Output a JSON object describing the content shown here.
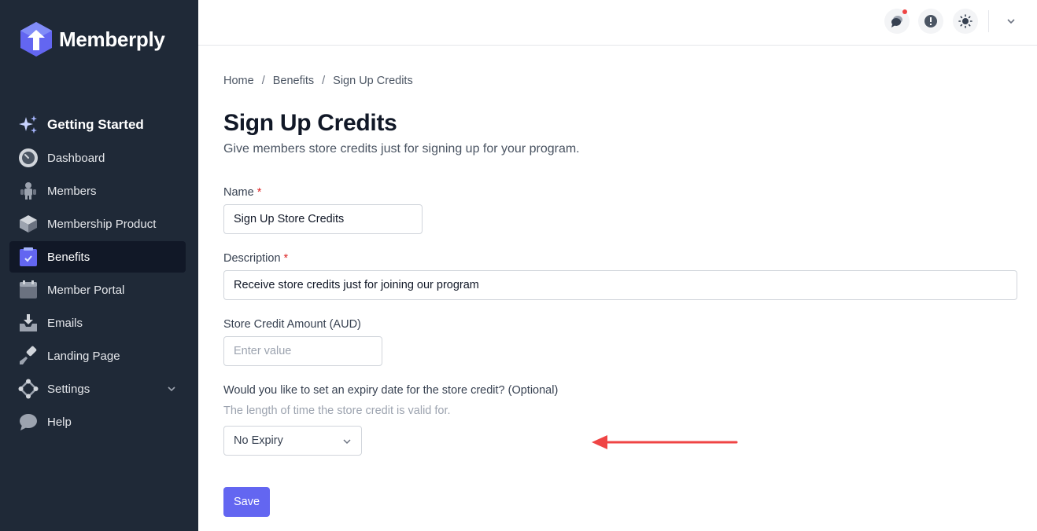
{
  "brand": {
    "name": "Memberply",
    "accent": "#6366f1",
    "sidebar_bg": "#1f2937"
  },
  "sidebar": {
    "items": [
      {
        "label": "Getting Started",
        "icon": "sparkles-icon"
      },
      {
        "label": "Dashboard",
        "icon": "gauge-icon"
      },
      {
        "label": "Members",
        "icon": "users-icon"
      },
      {
        "label": "Membership Product",
        "icon": "cube-icon"
      },
      {
        "label": "Benefits",
        "icon": "clipboard-check-icon",
        "active": true
      },
      {
        "label": "Member Portal",
        "icon": "calendar-icon"
      },
      {
        "label": "Emails",
        "icon": "inbox-download-icon"
      },
      {
        "label": "Landing Page",
        "icon": "brush-icon"
      },
      {
        "label": "Settings",
        "icon": "settings-diamond-icon",
        "has_submenu": true
      },
      {
        "label": "Help",
        "icon": "chat-bubble-icon"
      }
    ]
  },
  "topbar": {
    "icons": [
      "chat-icon",
      "alert-icon",
      "sun-icon",
      "chevron-down-icon"
    ],
    "notification_dot_color": "#ef4444"
  },
  "breadcrumb": [
    "Home",
    "Benefits",
    "Sign Up Credits"
  ],
  "breadcrumb_separator": "/",
  "page": {
    "title": "Sign Up Credits",
    "subtitle": "Give members store credits just for signing up for your program."
  },
  "form": {
    "name": {
      "label": "Name",
      "required_mark": "*",
      "value": "Sign Up Store Credits"
    },
    "description": {
      "label": "Description",
      "required_mark": "*",
      "value": "Receive store credits just for joining our program"
    },
    "amount": {
      "label": "Store Credit Amount (AUD)",
      "placeholder": "Enter value",
      "value": ""
    },
    "expiry": {
      "label": "Would you like to set an expiry date for the store credit? (Optional)",
      "helper": "The length of time the store credit is valid for.",
      "selected": "No Expiry"
    },
    "save_label": "Save"
  },
  "annotation": {
    "color": "#ef4444"
  }
}
